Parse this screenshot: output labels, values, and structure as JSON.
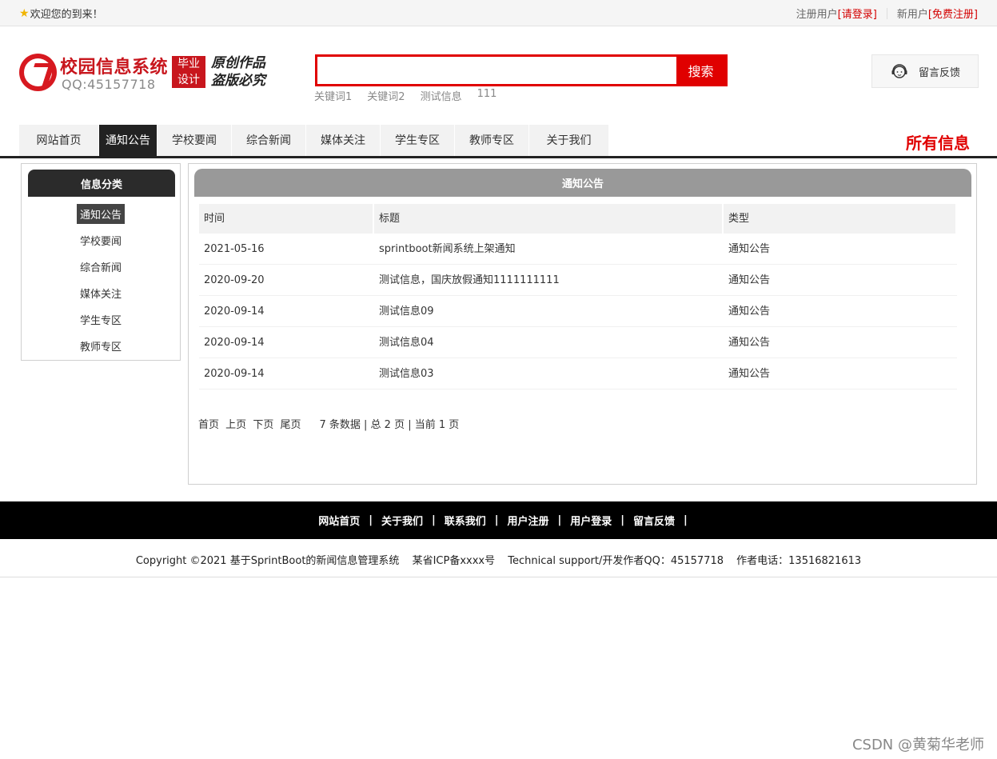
{
  "topbar": {
    "welcome": "欢迎您的到来！",
    "register_user_label": "注册用户",
    "login_link": "[请登录]",
    "new_user_label": "新用户",
    "signup_link": "[免费注册]"
  },
  "header": {
    "site_title": "校园信息系统",
    "qq": "QQ:45157718",
    "badge_line1": "毕业",
    "badge_line2": "设计",
    "motto_line1": "原创作品",
    "motto_line2": "盗版必究",
    "search_value": "",
    "search_button": "搜索",
    "keywords": [
      "关键词1",
      "关键词2",
      "测试信息",
      "111"
    ],
    "feedback_label": "留言反馈"
  },
  "nav": {
    "items": [
      "网站首页",
      "通知公告",
      "学校要闻",
      "综合新闻",
      "媒体关注",
      "学生专区",
      "教师专区",
      "关于我们"
    ],
    "active_index": 1,
    "all_info": "所有信息"
  },
  "sidebar": {
    "title": "信息分类",
    "items": [
      "通知公告",
      "学校要闻",
      "综合新闻",
      "媒体关注",
      "学生专区",
      "教师专区"
    ],
    "active_index": 0
  },
  "main": {
    "title": "通知公告",
    "columns": [
      "时间",
      "标题",
      "类型"
    ],
    "rows": [
      [
        "2021-05-16",
        "sprintboot新闻系统上架通知",
        "通知公告"
      ],
      [
        "2020-09-20",
        "测试信息，国庆放假通知1111111111",
        "通知公告"
      ],
      [
        "2020-09-14",
        "测试信息09",
        "通知公告"
      ],
      [
        "2020-09-14",
        "测试信息04",
        "通知公告"
      ],
      [
        "2020-09-14",
        "测试信息03",
        "通知公告"
      ]
    ],
    "pager": {
      "first": "首页",
      "prev": "上页",
      "next": "下页",
      "last": "尾页",
      "info": "7 条数据 | 总 2 页 | 当前 1 页"
    }
  },
  "footer": {
    "links": [
      "网站首页",
      "关于我们",
      "联系我们",
      "用户注册",
      "用户登录",
      "留言反馈"
    ],
    "copyright": "Copyright ©2021 基于SprintBoot的新闻信息管理系统",
    "icp": "某省ICP备xxxx号",
    "support": "Technical support/开发作者QQ：45157718",
    "phone": "作者电话：13516821613"
  },
  "watermark": "CSDN @黄菊华老师",
  "colors": {
    "brand_red": "#e00000",
    "dark": "#222222",
    "header_gray": "#999999"
  }
}
